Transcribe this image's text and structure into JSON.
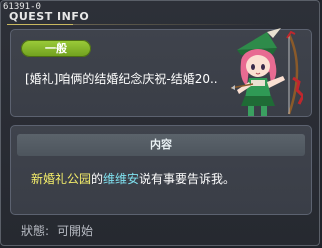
{
  "window": {
    "quest_id": "61391-0",
    "title": "QUEST INFO"
  },
  "quest": {
    "category": "一般",
    "name": "[婚礼]咱俩的结婚纪念庆祝-结婚20..",
    "npc_icon": "archer-girl-npc-portrait"
  },
  "content": {
    "header": "内容",
    "desc_location": "新婚礼公园",
    "desc_connector": "的",
    "desc_npc": "维维安",
    "desc_rest": "说有事要告诉我。"
  },
  "status": {
    "label": "狀態:",
    "value": "可開始"
  },
  "colors": {
    "badge": "#8bbf2c",
    "location_highlight": "#f5ee6a",
    "npc_highlight": "#7fe0ee"
  }
}
